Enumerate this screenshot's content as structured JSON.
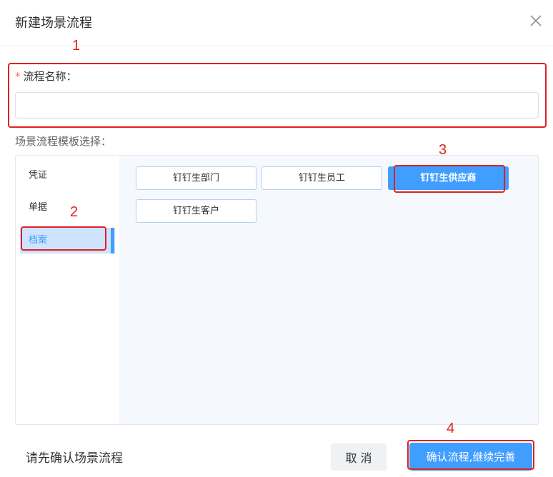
{
  "dialog": {
    "title": "新建场景流程",
    "close_icon": "close-icon"
  },
  "form": {
    "required_mark": "*",
    "name_label": "流程名称：",
    "name_value": "",
    "name_placeholder": "",
    "template_label": "场景流程模板选择："
  },
  "categories": [
    {
      "label": "凭证",
      "active": false
    },
    {
      "label": "单据",
      "active": false
    },
    {
      "label": "档案",
      "active": true
    }
  ],
  "templates": [
    {
      "label": "钉钉生部门",
      "active": false
    },
    {
      "label": "钉钉生员工",
      "active": false
    },
    {
      "label": "钉钉生供应商",
      "active": true
    },
    {
      "label": "钉钉生客户",
      "active": false
    }
  ],
  "footer": {
    "hint": "请先确认场景流程",
    "cancel_label": "取 消",
    "confirm_label": "确认流程,继续完善"
  },
  "annotations": [
    "1",
    "2",
    "3",
    "4"
  ],
  "colors": {
    "accent": "#409eff",
    "annotation": "#e02020",
    "active_category_bg": "#cfe3ff",
    "panel_bg": "#f5f8fc"
  }
}
